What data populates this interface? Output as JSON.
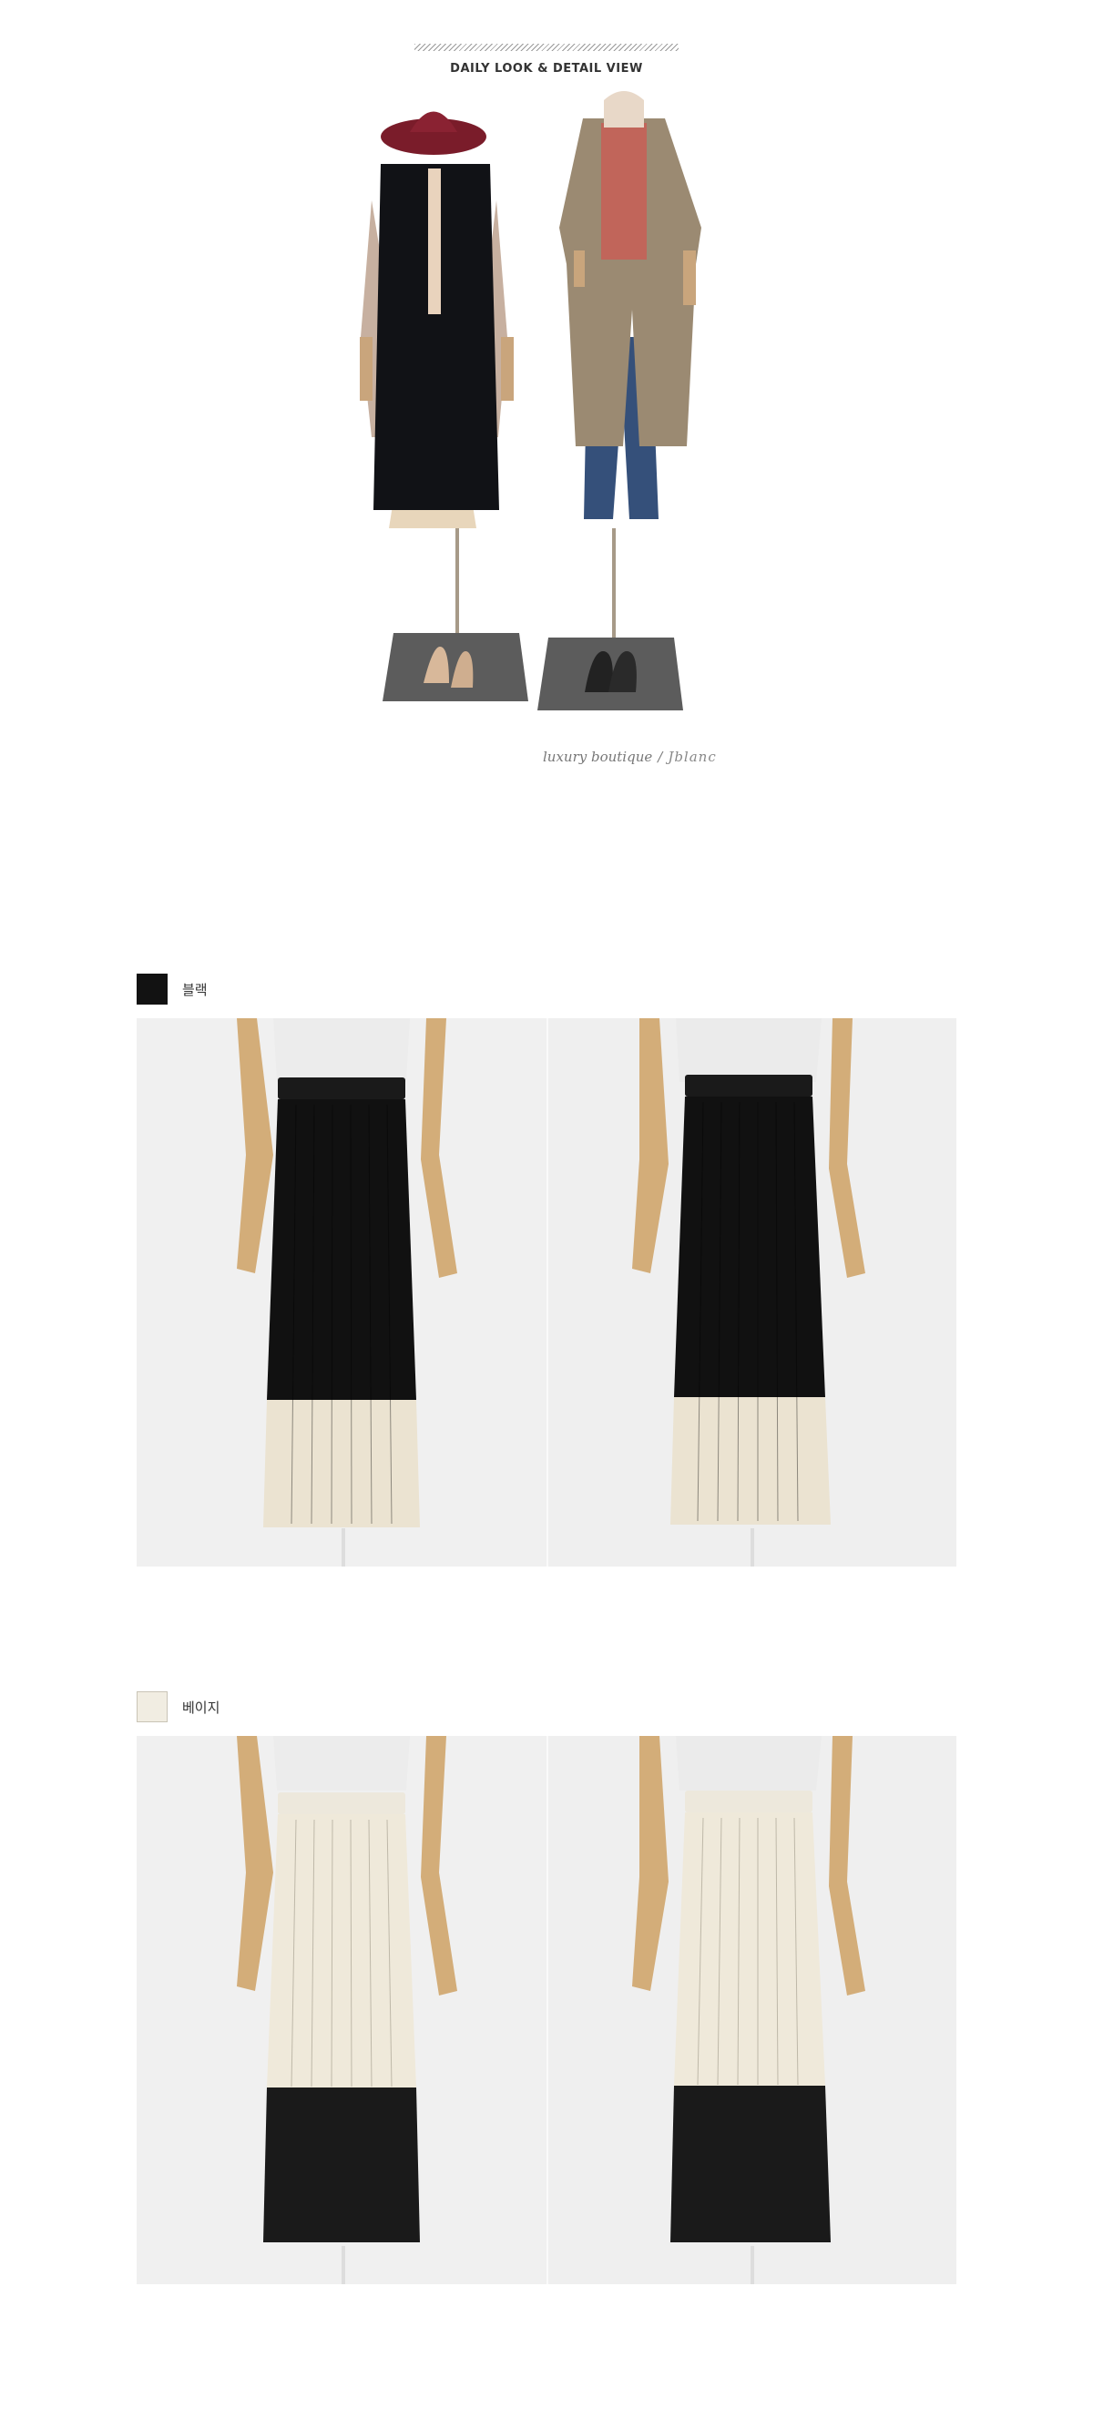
{
  "header": {
    "title": "DAILY LOOK & DETAIL VIEW"
  },
  "signature": {
    "text": "luxury boutique",
    "separator": "/",
    "brand": "Jblanc"
  },
  "colors": [
    {
      "label": "블랙",
      "swatch_color": "#121212",
      "photos": [
        "black-skirt-front",
        "black-skirt-angle"
      ]
    },
    {
      "label": "베이지",
      "swatch_color": "#f1ede2",
      "photos": [
        "beige-skirt-front",
        "beige-skirt-angle"
      ]
    }
  ]
}
